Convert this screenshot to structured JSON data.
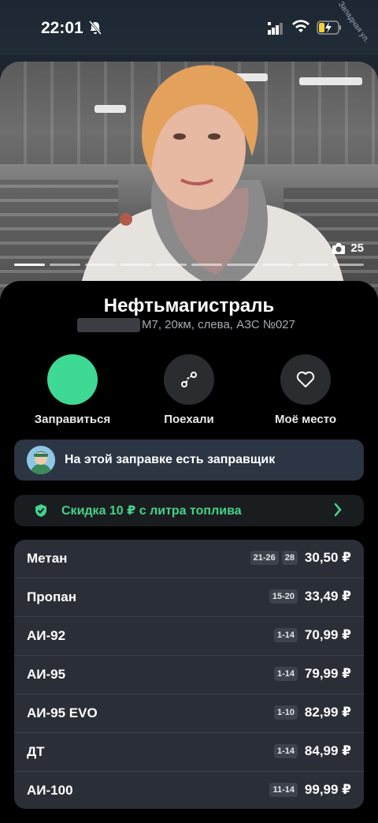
{
  "status": {
    "time": "22:01",
    "map_label": "Западная ул."
  },
  "photo": {
    "count": "25",
    "dots": 10
  },
  "station": {
    "name": "Нефтьмагистраль",
    "address": "М7, 20км, слева, АЗС №027"
  },
  "actions": [
    {
      "label": "Заправиться"
    },
    {
      "label": "Поехали"
    },
    {
      "label": "Моё место"
    }
  ],
  "attendant": {
    "text": "На этой заправке есть заправщик"
  },
  "discount": {
    "text": "Скидка 10 ₽ с литра топлива"
  },
  "fuels": [
    {
      "name": "Метан",
      "badges": [
        "21-26",
        "28"
      ],
      "price": "30,50 ₽"
    },
    {
      "name": "Пропан",
      "badges": [
        "15-20"
      ],
      "price": "33,49 ₽"
    },
    {
      "name": "АИ-92",
      "badges": [
        "1-14"
      ],
      "price": "70,99 ₽"
    },
    {
      "name": "АИ-95",
      "badges": [
        "1-14"
      ],
      "price": "79,99 ₽"
    },
    {
      "name": "АИ-95 EVO",
      "badges": [
        "1-10"
      ],
      "price": "82,99 ₽"
    },
    {
      "name": "ДТ",
      "badges": [
        "1-14"
      ],
      "price": "84,99 ₽"
    },
    {
      "name": "АИ-100",
      "badges": [
        "11-14"
      ],
      "price": "99,99 ₽"
    }
  ],
  "colors": {
    "accent_green": "#3dd995",
    "discount_green": "#45d28a",
    "sheet": "#000000"
  }
}
